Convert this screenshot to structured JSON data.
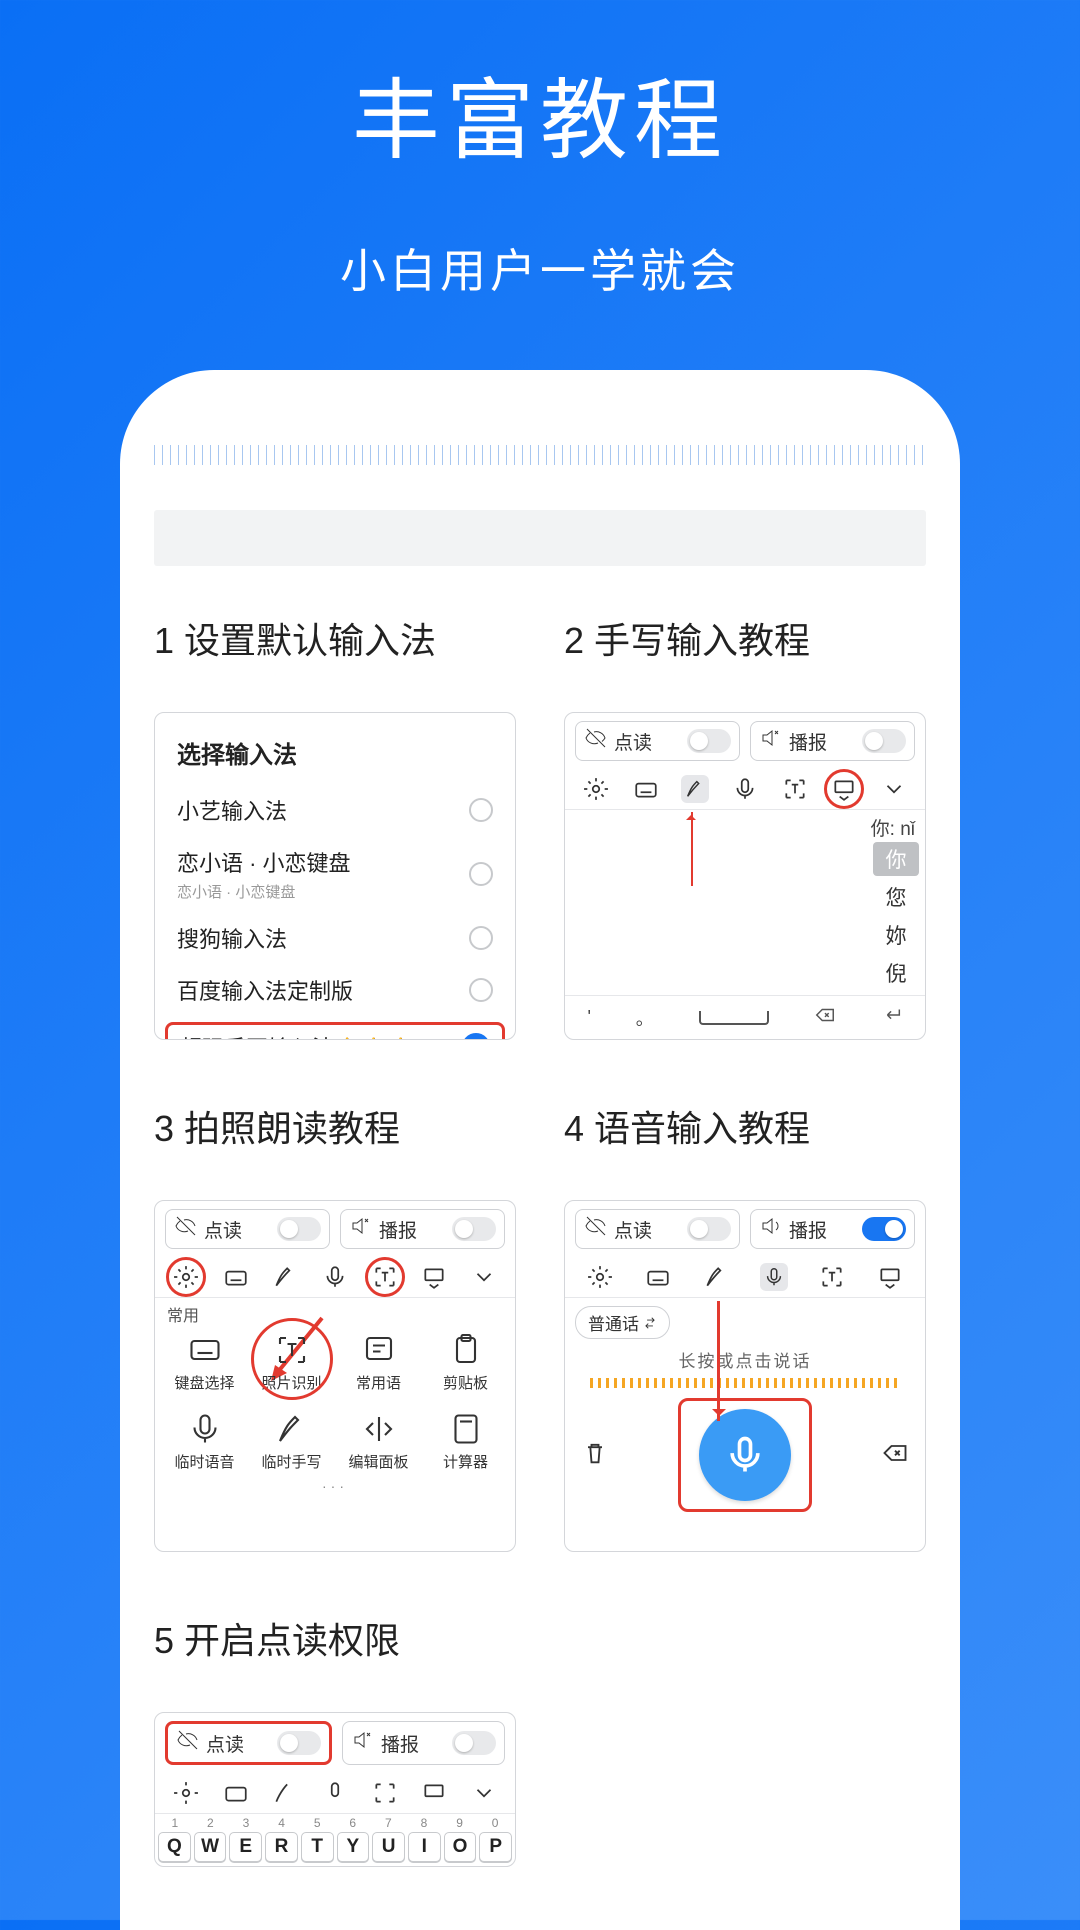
{
  "page": {
    "title": "丰富教程",
    "subtitle": "小白用户一学就会"
  },
  "steps": {
    "s1": {
      "title": "1 设置默认输入法",
      "header": "选择输入法",
      "options": [
        {
          "label": "小艺输入法"
        },
        {
          "label": "恋小语 · 小恋键盘",
          "sub": "恋小语 · 小恋键盘"
        },
        {
          "label": "搜狗输入法"
        },
        {
          "label": "百度输入法定制版"
        }
      ],
      "highlight_label": "超强手写输入法",
      "finger": "👉"
    },
    "s2": {
      "title": "2 手写输入教程",
      "toggle_read": "点读",
      "toggle_speak": "播报",
      "hint_prefix": "你:",
      "hint_pinyin": "nǐ",
      "candidates": [
        "你",
        "您",
        "妳",
        "倪"
      ],
      "bottom_sym1": "'",
      "bottom_sym2": "。"
    },
    "s3": {
      "title": "3 拍照朗读教程",
      "toggle_read": "点读",
      "toggle_speak": "播报",
      "group_label": "常用",
      "items": [
        "键盘选择",
        "照片识别",
        "常用语",
        "剪贴板",
        "临时语音",
        "临时手写",
        "编辑面板",
        "计算器"
      ],
      "more": "···"
    },
    "s4": {
      "title": "4 语音输入教程",
      "toggle_read": "点读",
      "toggle_speak": "播报",
      "lang_pill": "普通话",
      "tip": "长按或点击说话"
    },
    "s5": {
      "title": "5 开启点读权限",
      "toggle_read": "点读",
      "toggle_speak": "播报",
      "nums": [
        "1",
        "2",
        "3",
        "4",
        "5",
        "6",
        "7",
        "8",
        "9",
        "0"
      ],
      "keys": [
        "Q",
        "W",
        "E",
        "R",
        "T",
        "Y",
        "U",
        "I",
        "O",
        "P"
      ]
    }
  }
}
